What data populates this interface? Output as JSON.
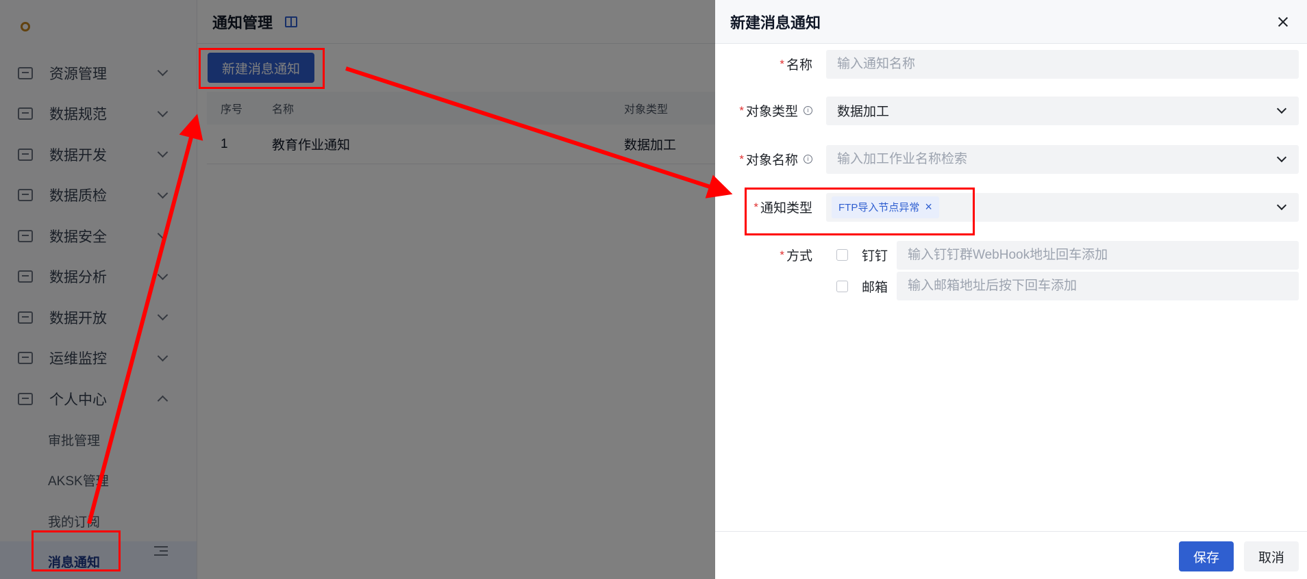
{
  "sidebar": {
    "menu": [
      {
        "label": "资源管理",
        "icon": "monitor-icon"
      },
      {
        "label": "数据规范",
        "icon": "monitor-icon"
      },
      {
        "label": "数据开发",
        "icon": "monitor-icon"
      },
      {
        "label": "数据质检",
        "icon": "monitor-icon"
      },
      {
        "label": "数据安全",
        "icon": "monitor-icon"
      },
      {
        "label": "数据分析",
        "icon": "chart-icon"
      },
      {
        "label": "数据开放",
        "icon": "monitor-icon"
      },
      {
        "label": "运维监控",
        "icon": "monitor-icon"
      },
      {
        "label": "个人中心",
        "icon": "user-icon"
      }
    ],
    "sub_items": [
      {
        "label": "审批管理"
      },
      {
        "label": "AKSK管理"
      },
      {
        "label": "我的订阅"
      },
      {
        "label": "消息通知"
      }
    ]
  },
  "main": {
    "title": "通知管理",
    "new_button": "新建消息通知",
    "columns": [
      "序号",
      "名称",
      "对象类型"
    ],
    "rows": [
      {
        "idx": "1",
        "name": "教育作业通知",
        "type": "数据加工"
      }
    ]
  },
  "drawer": {
    "title": "新建消息通知",
    "fields": {
      "name": {
        "label": "名称",
        "placeholder": "输入通知名称"
      },
      "object_type": {
        "label": "对象类型",
        "value": "数据加工"
      },
      "object_name": {
        "label": "对象名称",
        "placeholder": "输入加工作业名称检索"
      },
      "notify_type": {
        "label": "通知类型",
        "tag": "FTP导入节点异常"
      },
      "method": {
        "label": "方式",
        "options": [
          {
            "label": "钉钉",
            "placeholder": "输入钉钉群WebHook地址回车添加"
          },
          {
            "label": "邮箱",
            "placeholder": "输入邮箱地址后按下回车添加"
          }
        ]
      }
    },
    "save": "保存",
    "cancel": "取消"
  },
  "colors": {
    "primary": "#2f5fd0",
    "annotation": "#ff0000",
    "required": "#e03131"
  }
}
